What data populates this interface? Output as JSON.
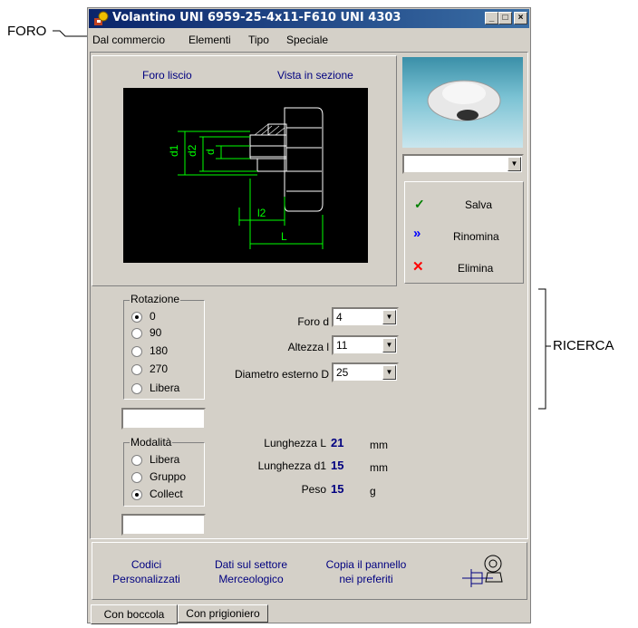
{
  "annotations": {
    "left": "FORO",
    "right": "RICERCA"
  },
  "window": {
    "title": "Volantino UNI 6959-25-4x11-F610 UNI 4303",
    "min": "_",
    "max": "□",
    "close": "×"
  },
  "menu": [
    "Dal commercio",
    "Elementi",
    "Tipo",
    "Speciale"
  ],
  "drawing": {
    "left_title": "Foro liscio",
    "right_title": "Vista in sezione",
    "dims": {
      "d1": "d1",
      "d2": "d2",
      "d": "d",
      "l2": "l2",
      "L": "L"
    }
  },
  "preview": {
    "combo_value": ""
  },
  "actions": [
    {
      "label": "Salva",
      "icon": "check-icon",
      "color": "#008000"
    },
    {
      "label": "Rinomina",
      "icon": "double-chevron-icon",
      "color": "#0000ff"
    },
    {
      "label": "Elimina",
      "icon": "x-icon",
      "color": "#ff0000"
    }
  ],
  "rotazione": {
    "title": "Rotazione",
    "options": [
      "0",
      "90",
      "180",
      "270",
      "Libera"
    ],
    "selected": 0,
    "text": ""
  },
  "modalita": {
    "title": "Modalità",
    "options": [
      "Libera",
      "Gruppo",
      "Collect"
    ],
    "selected": 2,
    "text": ""
  },
  "fields": [
    {
      "label": "Foro d",
      "value": "4"
    },
    {
      "label": "Altezza l",
      "value": "11"
    },
    {
      "label": "Diametro esterno D",
      "value": "25"
    }
  ],
  "results": [
    {
      "label": "Lunghezza L",
      "value": "21",
      "unit": "mm"
    },
    {
      "label": "Lunghezza d1",
      "value": "15",
      "unit": "mm"
    },
    {
      "label": "Peso",
      "value": "15",
      "unit": "g"
    }
  ],
  "footer": {
    "codici": [
      "Codici",
      "Personalizzati"
    ],
    "dati": [
      "Dati sul settore",
      "Merceologico"
    ],
    "copia": [
      "Copia il pannello",
      "nei preferiti"
    ]
  },
  "tabs": [
    "Con boccola",
    "Con prigioniero"
  ]
}
